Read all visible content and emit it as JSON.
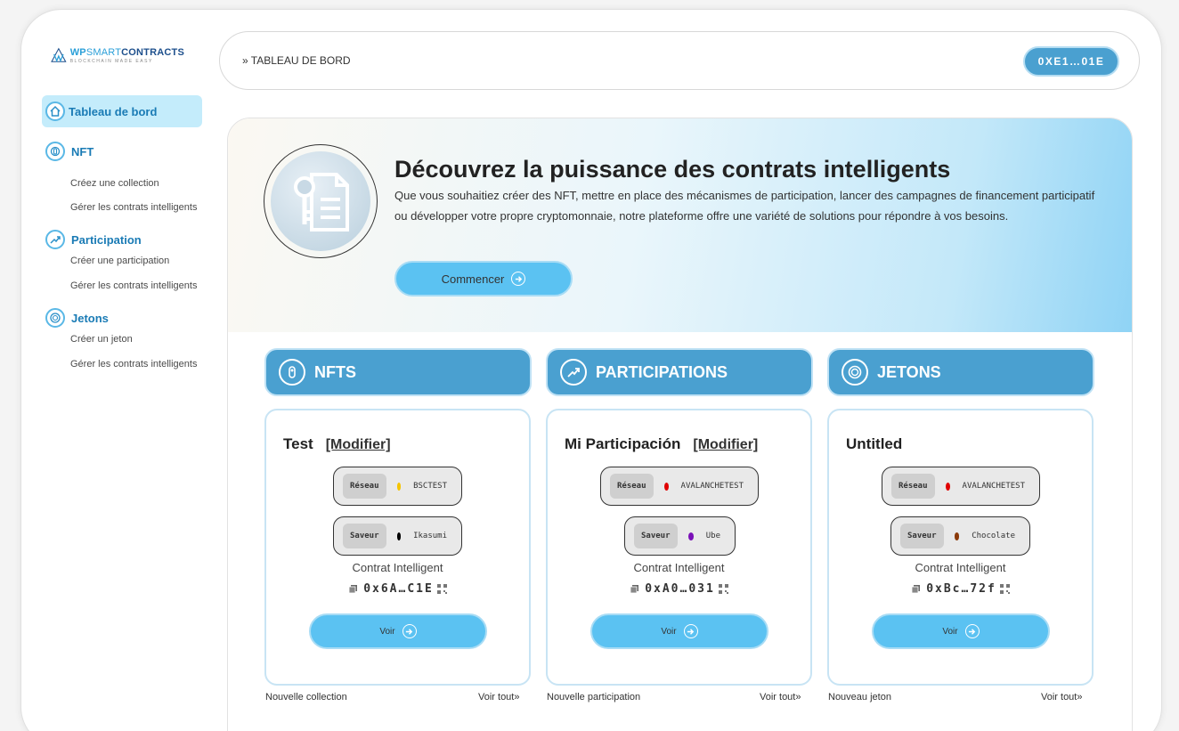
{
  "logo": {
    "brand_wp": "WP",
    "brand_smart": "SMART",
    "brand_contracts": "CONTRACTS",
    "tagline": "BLOCKCHAIN MADE EASY"
  },
  "sidebar": {
    "active": {
      "label": "Tableau de bord",
      "icon": "home-icon"
    },
    "sections": [
      {
        "label": "NFT",
        "icon": "nft-icon",
        "items": [
          "Créez une collection",
          "Gérer les contrats intelligents"
        ]
      },
      {
        "label": "Participation",
        "icon": "chart-up-icon",
        "items": [
          "Créer une participation",
          "Gérer les contrats intelligents"
        ]
      },
      {
        "label": "Jetons",
        "icon": "coin-icon",
        "items": [
          "Créer un jeton",
          "Gérer les contrats intelligents"
        ]
      }
    ]
  },
  "header": {
    "breadcrumb": "» TABLEAU DE BORD",
    "wallet": "0XE1…01E"
  },
  "hero": {
    "title": "Découvrez la puissance des contrats intelligents",
    "text": "Que vous souhaitiez créer des NFT, mettre en place des mécanismes de participation, lancer des campagnes de financement participatif ou développer votre propre cryptomonnaie, notre plateforme offre une variété de solutions pour répondre à vos besoins.",
    "button": "Commencer"
  },
  "columns": [
    {
      "heading": "NFTS",
      "icon": "nft-icon",
      "card": {
        "title": "Test",
        "modify": "[Modifier]",
        "network_tag": "Réseau",
        "network": "BSCTEST",
        "network_color": "#f5c400",
        "flavor_tag": "Saveur",
        "flavor": "Ikasumi",
        "flavor_color": "#000000",
        "contract_label": "Contrat Intelligent",
        "address": "0x6A…C1E",
        "button": "Voir"
      },
      "footer_left": "Nouvelle collection",
      "footer_right": "Voir tout»"
    },
    {
      "heading": "PARTICIPATIONS",
      "icon": "chart-up-icon",
      "card": {
        "title": "Mi Participación",
        "modify": "[Modifier]",
        "network_tag": "Réseau",
        "network": "AVALANCHETEST",
        "network_color": "#e00000",
        "flavor_tag": "Saveur",
        "flavor": "Ube",
        "flavor_color": "#7a10b8",
        "contract_label": "Contrat Intelligent",
        "address": "0xA0…031",
        "button": "Voir"
      },
      "footer_left": "Nouvelle participation",
      "footer_right": "Voir tout»"
    },
    {
      "heading": "JETONS",
      "icon": "coin-icon",
      "card": {
        "title": "Untitled",
        "modify": "",
        "network_tag": "Réseau",
        "network": "AVALANCHETEST",
        "network_color": "#e00000",
        "flavor_tag": "Saveur",
        "flavor": "Chocolate",
        "flavor_color": "#8b3a0a",
        "contract_label": "Contrat Intelligent",
        "address": "0xBc…72f",
        "button": "Voir"
      },
      "footer_left": "Nouveau jeton",
      "footer_right": "Voir tout»"
    }
  ]
}
